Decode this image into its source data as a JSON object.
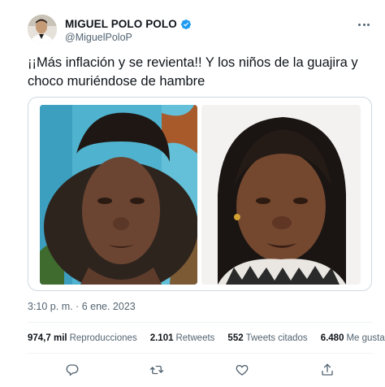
{
  "author": {
    "display_name": "MIGUEL POLO POLO",
    "handle": "@MiguelPoloP",
    "verified": true
  },
  "tweet": {
    "text": "¡¡Más inflación y se revienta!! Y los niños de la guajira y choco muriéndose de hambre",
    "timestamp": "3:10 p. m. · 6 ene. 2023"
  },
  "stats": [
    {
      "value": "974,7 mil",
      "label": "Reproducciones"
    },
    {
      "value": "2.101",
      "label": "Retweets"
    },
    {
      "value": "552",
      "label": "Tweets citados"
    },
    {
      "value": "6.480",
      "label": "Me gusta"
    }
  ],
  "icons": {
    "verified": "verified-badge-icon",
    "more": "more-options-icon",
    "reply": "reply-icon",
    "retweet": "retweet-icon",
    "like": "heart-icon",
    "share": "share-icon"
  },
  "colors": {
    "text_primary": "#0f1419",
    "text_secondary": "#536471",
    "verified_blue": "#1d9bf0",
    "border": "#cfd9de"
  }
}
